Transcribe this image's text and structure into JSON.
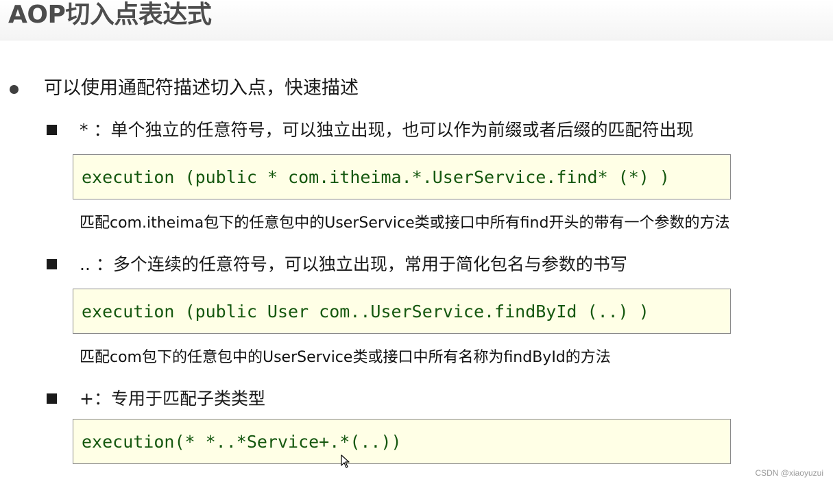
{
  "title": "AOP切入点表达式",
  "main_point": "可以使用通配符描述切入点，快速描述",
  "items": [
    {
      "label": "* ：单个独立的任意符号，可以独立出现，也可以作为前缀或者后缀的匹配符出现",
      "code": "execution (public * com.itheima.*.UserService.find* (*) )",
      "description": "匹配com.itheima包下的任意包中的UserService类或接口中所有find开头的带有一个参数的方法"
    },
    {
      "label": ".. ：多个连续的任意符号，可以独立出现，常用于简化包名与参数的书写",
      "code": "execution (public User com..UserService.findById (..) )",
      "description": "匹配com包下的任意包中的UserService类或接口中所有名称为findById的方法"
    },
    {
      "label": "+：专用于匹配子类类型",
      "code": "execution(* *..*Service+.*(..))"
    }
  ],
  "watermark": "CSDN @xiaoyuzui",
  "icons": {
    "main_bullet": "bullet-dot-icon",
    "sub_bullet": "square-bullet-icon",
    "cursor": "mouse-pointer-icon"
  }
}
